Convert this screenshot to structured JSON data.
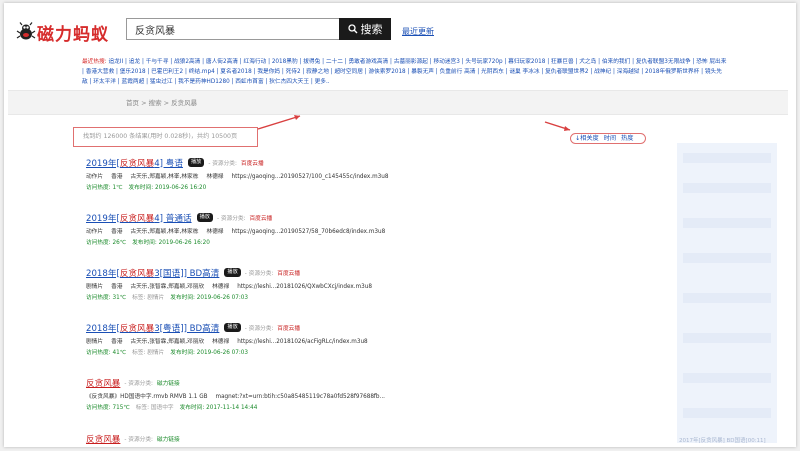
{
  "logo": {
    "text": "磁力蚂蚁"
  },
  "search": {
    "value": "反贪风暴",
    "button_label": "搜索"
  },
  "header": {
    "latest_link": "最近更新"
  },
  "hot": {
    "label": "最近热搜:",
    "terms": [
      "追龙II",
      "追龙",
      "千与千寻",
      "战狼2高清",
      "唐人街2高清",
      "红海行动",
      "2018黑豹",
      "拔得兔",
      "二十二",
      "勇敢者游戏高清",
      "古墓丽影源起",
      "移动迷宫3",
      "头号玩家720p",
      "暮归玩家2018",
      "狂暴巨兽",
      "犬之岛",
      "伯来的我们",
      "复仇者联盟3无限战争",
      "恐怖 屁出来",
      "香港大营救",
      "堡乐2018",
      "巴霍巴利王2",
      "终结.mp4",
      "夏名者2018",
      "我是你妈",
      "死侍2",
      "寂静之地",
      "超时空同居",
      "游侠索罗2018",
      "暴裂无声",
      "负重前行 高清",
      "光阴西东",
      "谜巢 李冰冰",
      "复仇者联盟世界2",
      "战神纪",
      "深海越狱",
      "2018年俄罗斯世界杯",
      "镜头先敌",
      "环太平洋",
      "蓝霞两超",
      "猛虫过江",
      "我不是药神HD1280",
      "西虹市首富",
      "狄仁杰四大天王",
      "更多.."
    ]
  },
  "breadcrumb": "首页 > 搜索 > 反贪风暴",
  "stats": "找到约  126000  条结果(用时 0.028秒)，共约 10500页",
  "sort": {
    "options": [
      "↓相关度",
      "时间",
      "热度"
    ]
  },
  "results": [
    {
      "title_pre": "2019年[",
      "title_hl": "反贪风暴",
      "title_post": "4] 粤语",
      "tag": "播放",
      "type_label": "- 资源分类:",
      "type_value": "百度云播",
      "desc": [
        "动作片",
        "香港",
        "古天乐,郑嘉颖,林峯,林家栋",
        "林德禄",
        "https://gaoqing...20190527/100_c145455c/index.m3u8"
      ],
      "heat_label": "访问热度:",
      "heat": "1℃",
      "time_label": "发布时间:",
      "time": "2019-06-26 16:20"
    },
    {
      "title_pre": "2019年[",
      "title_hl": "反贪风暴",
      "title_post": "4] 普通话",
      "tag": "播放",
      "type_label": "- 资源分类:",
      "type_value": "百度云播",
      "desc": [
        "动作片",
        "香港",
        "古天乐,郑嘉颖,林峯,林家栋",
        "林德禄",
        "https://gaoqing...20190527/58_70b6edc8/index.m3u8"
      ],
      "heat_label": "访问热度:",
      "heat": "26℃",
      "time_label": "发布时间:",
      "time": "2019-06-26 16:20"
    },
    {
      "title_pre": "2018年[",
      "title_hl": "反贪风暴",
      "title_post": "3[国语]] BD高清",
      "tag": "播放",
      "type_label": "- 资源分类:",
      "type_value": "百度云播",
      "desc": [
        "剧情片",
        "香港",
        "古天乐,张智霖,郑嘉颖,邓丽欣",
        "林德禄",
        "https://leshi...20181026/QXwbCXcj/index.m3u8"
      ],
      "heat_label": "访问热度:",
      "heat": "31℃",
      "tag_label": "标签:",
      "tag_value": "剧情片",
      "time_label": "发布时间:",
      "time": "2019-06-26 07:03"
    },
    {
      "title_pre": "2018年[",
      "title_hl": "反贪风暴",
      "title_post": "3[粤语]] BD高清",
      "tag": "播放",
      "type_label": "- 资源分类:",
      "type_value": "百度云播",
      "desc": [
        "剧情片",
        "香港",
        "古天乐,张智霖,郑嘉颖,邓丽欣",
        "林德禄",
        "https://leshi...20181026/acFigRLc/index.m3u8"
      ],
      "heat_label": "访问热度:",
      "heat": "41℃",
      "tag_label": "标签:",
      "tag_value": "剧情片",
      "time_label": "发布时间:",
      "time": "2019-06-26 07:03"
    },
    {
      "title_pre": "",
      "title_hl": "反贪风暴",
      "title_post": "",
      "type_label": "- 资源分类:",
      "type_value": "磁力链接",
      "desc": [
        "《反贪风暴》HD国语中字.rmvb RMVB 1.1 GB",
        "magnet:?xt=urn:btih:c50a85485119c78a0fd528f97688fb..."
      ],
      "heat_label": "访问热度:",
      "heat": "715℃",
      "tag_label": "标签:",
      "tag_value": "国语中字",
      "time_label": "发布时间:",
      "time": "2017-11-14 14:44"
    },
    {
      "title_pre": "",
      "title_hl": "反贪风暴",
      "title_post": "",
      "type_label": "- 资源分类:",
      "type_value": "磁力链接"
    }
  ],
  "side_footer": "2017年[反贪风暴] BD国语[00:11]",
  "colors": {
    "brand_red": "#d62c2c",
    "link_blue": "#1a4fb5",
    "green": "#1a8a2a",
    "annotation_red": "#e07070"
  }
}
